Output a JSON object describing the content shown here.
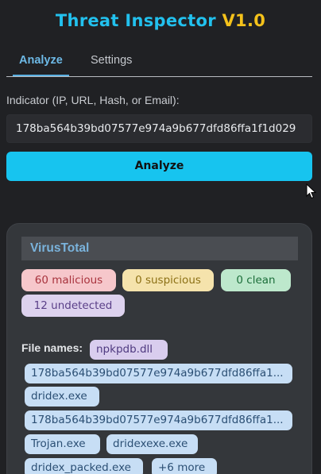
{
  "header": {
    "title_name": "Threat Inspector",
    "title_version": "V1.0"
  },
  "tabs": [
    {
      "label": "Analyze",
      "active": true
    },
    {
      "label": "Settings",
      "active": false
    }
  ],
  "form": {
    "indicator_label": "Indicator (IP, URL, Hash, or Email):",
    "indicator_value": "178ba564b39bd07577e974a9b677dfd86ffa1f1d029",
    "analyze_label": "Analyze"
  },
  "virustotal": {
    "title": "VirusTotal",
    "stats": {
      "malicious": "60 malicious",
      "suspicious": "0 suspicious",
      "clean": "0 clean",
      "undetected": "12 undetected"
    },
    "file_names_label": "File names:",
    "file_names": [
      "npkpdb.dll",
      "178ba564b39bd07577e974a9b677dfd86ffa1...",
      "dridex.exe",
      "178ba564b39bd07577e974a9b677dfd86ffa1...",
      "Trojan.exe",
      "dridexexe.exe",
      "dridex_packed.exe",
      "+6 more"
    ]
  },
  "colors": {
    "background": "#202124",
    "accent": "#22c1ee",
    "version": "#f4c21b",
    "malicious": "#f6c7cb",
    "suspicious": "#f5e3ac",
    "clean": "#bde8cc",
    "undetected": "#ddd2ee"
  },
  "icons": {
    "cursor": "mouse-pointer-icon"
  }
}
